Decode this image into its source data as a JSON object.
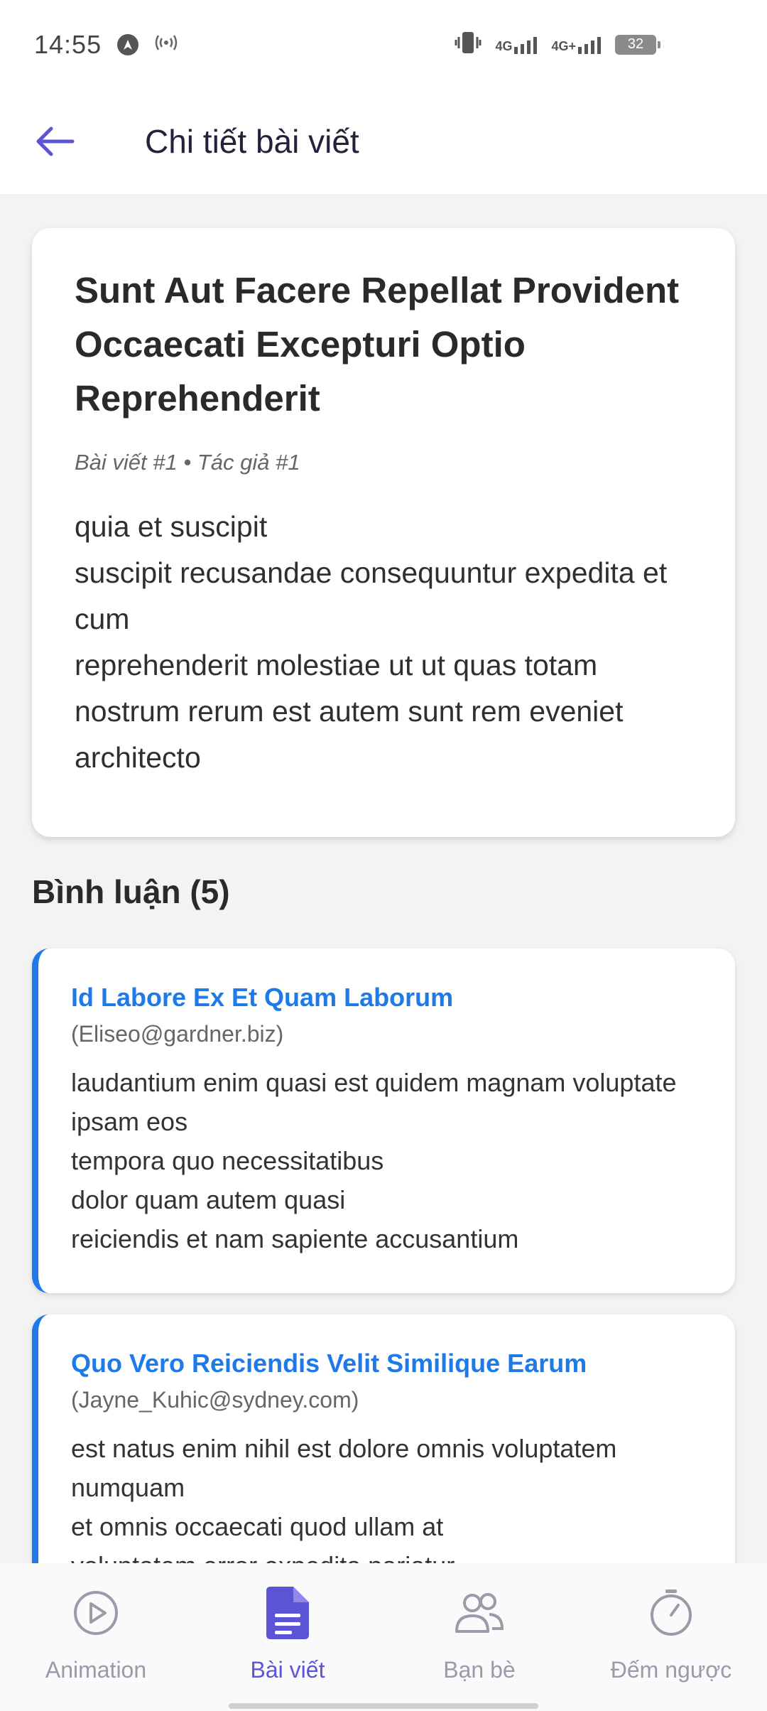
{
  "status": {
    "time": "14:55",
    "net1": "4G",
    "net2": "4G+",
    "battery": "32"
  },
  "header": {
    "title": "Chi tiết bài viết"
  },
  "post": {
    "title": "Sunt Aut Facere Repellat Provident Occaecati Excepturi Optio Reprehenderit",
    "meta": "Bài viết #1 • Tác giả #1",
    "body": "quia et suscipit\nsuscipit recusandae consequuntur expedita et cum\nreprehenderit molestiae ut ut quas totam\nnostrum rerum est autem sunt rem eveniet architecto"
  },
  "comments": {
    "heading": "Bình luận (5)",
    "items": [
      {
        "title": "Id Labore Ex Et Quam Laborum",
        "email": "(Eliseo@gardner.biz)",
        "body": "laudantium enim quasi est quidem magnam voluptate ipsam eos\ntempora quo necessitatibus\ndolor quam autem quasi\nreiciendis et nam sapiente accusantium"
      },
      {
        "title": "Quo Vero Reiciendis Velit Similique Earum",
        "email": "(Jayne_Kuhic@sydney.com)",
        "body": "est natus enim nihil est dolore omnis voluptatem numquam\net omnis occaecati quod ullam at\nvoluptatem error expedita pariatur"
      }
    ]
  },
  "nav": {
    "items": [
      {
        "label": "Animation",
        "icon": "play-circle-icon"
      },
      {
        "label": "Bài viết",
        "icon": "document-icon"
      },
      {
        "label": "Bạn bè",
        "icon": "people-icon"
      },
      {
        "label": "Đếm ngược",
        "icon": "timer-icon"
      }
    ],
    "active_index": 1
  },
  "colors": {
    "accent": "#5b55d6",
    "comment_accent": "#1e7ae8",
    "nav_inactive": "#9a9aa8"
  }
}
